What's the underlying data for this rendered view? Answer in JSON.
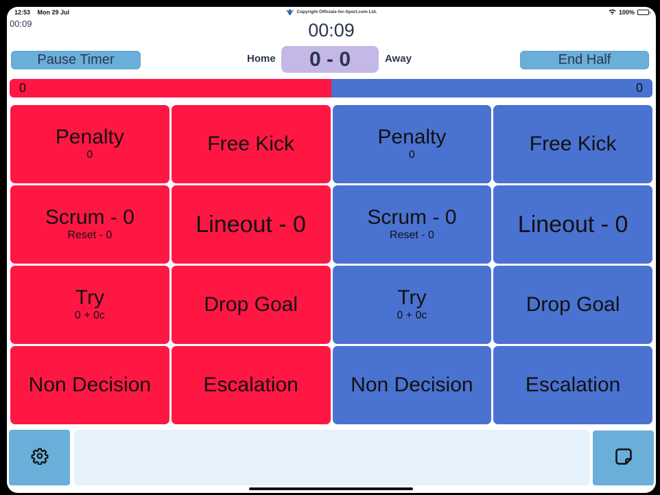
{
  "status_bar": {
    "time": "12:53",
    "date": "Mon 29 Jul",
    "battery_percent": "100%",
    "wifi_icon": "wifi-icon",
    "battery_icon": "battery-icon"
  },
  "copyright": "Copyright Officials-for-Sport.com Ltd.",
  "timer": {
    "small": "00:09",
    "main": "00:09"
  },
  "buttons": {
    "pause_timer": "Pause Timer",
    "end_half": "End Half"
  },
  "score": {
    "home_label": "Home",
    "away_label": "Away",
    "display": "0 - 0"
  },
  "possession": {
    "home_value": "0",
    "away_value": "0",
    "home_fraction": 0.5,
    "home_color": "#ff1744",
    "away_color": "#4a72d1"
  },
  "grid": {
    "home": {
      "penalty": {
        "title": "Penalty",
        "sub": "0"
      },
      "free_kick": {
        "title": "Free Kick"
      },
      "scrum": {
        "title": "Scrum - 0",
        "sub": "Reset - 0"
      },
      "lineout": {
        "title": "Lineout - 0"
      },
      "try": {
        "title": "Try",
        "sub": "0 + 0c"
      },
      "drop_goal": {
        "title": "Drop Goal"
      },
      "non_decision": {
        "title": "Non Decision"
      },
      "escalation": {
        "title": "Escalation"
      }
    },
    "away": {
      "penalty": {
        "title": "Penalty",
        "sub": "0"
      },
      "free_kick": {
        "title": "Free Kick"
      },
      "scrum": {
        "title": "Scrum - 0",
        "sub": "Reset - 0"
      },
      "lineout": {
        "title": "Lineout - 0"
      },
      "try": {
        "title": "Try",
        "sub": "0 + 0c"
      },
      "drop_goal": {
        "title": "Drop Goal"
      },
      "non_decision": {
        "title": "Non Decision"
      },
      "escalation": {
        "title": "Escalation"
      }
    }
  },
  "bottom": {
    "notes_text": "",
    "settings_icon": "gear-icon",
    "notes_icon": "sticky-note-icon"
  }
}
